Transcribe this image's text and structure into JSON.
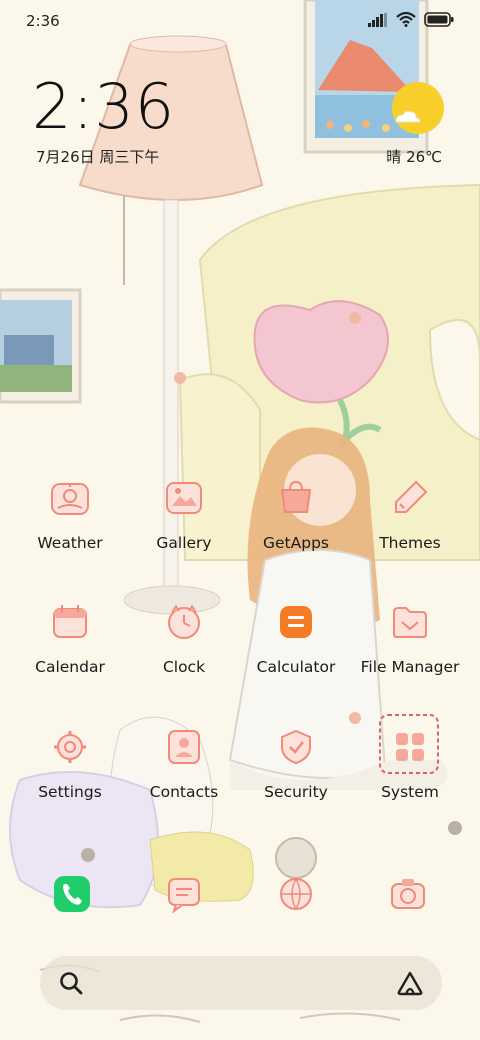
{
  "status_bar": {
    "time": "2:36",
    "battery_icon": "battery-icon",
    "wifi_icon": "wifi-icon",
    "signal_icon": "signal-icon"
  },
  "clock_widget": {
    "time": "2:36",
    "date": "7月26日 周三下午"
  },
  "weather_widget": {
    "text": "晴 26℃",
    "icon": "sun-cloud-icon"
  },
  "apps": [
    {
      "label": "Weather",
      "icon": "weather-icon"
    },
    {
      "label": "Gallery",
      "icon": "gallery-icon"
    },
    {
      "label": "GetApps",
      "icon": "getapps-icon"
    },
    {
      "label": "Themes",
      "icon": "themes-icon"
    },
    {
      "label": "Calendar",
      "icon": "calendar-icon"
    },
    {
      "label": "Clock",
      "icon": "clock-icon"
    },
    {
      "label": "Calculator",
      "icon": "calculator-icon"
    },
    {
      "label": "File Manager",
      "icon": "file-manager-icon"
    },
    {
      "label": "Settings",
      "icon": "settings-icon"
    },
    {
      "label": "Contacts",
      "icon": "contacts-icon"
    },
    {
      "label": "Security",
      "icon": "security-icon"
    },
    {
      "label": "System",
      "icon": "system-folder-icon"
    }
  ],
  "dock": [
    {
      "icon": "phone-icon"
    },
    {
      "icon": "messages-icon"
    },
    {
      "icon": "browser-icon"
    },
    {
      "icon": "camera-icon"
    }
  ],
  "colors": {
    "accent_icon": "#f08a7a",
    "phone_green": "#1fce6a",
    "calculator_orange": "#f57c26",
    "sun_yellow": "#f8cf2a"
  }
}
